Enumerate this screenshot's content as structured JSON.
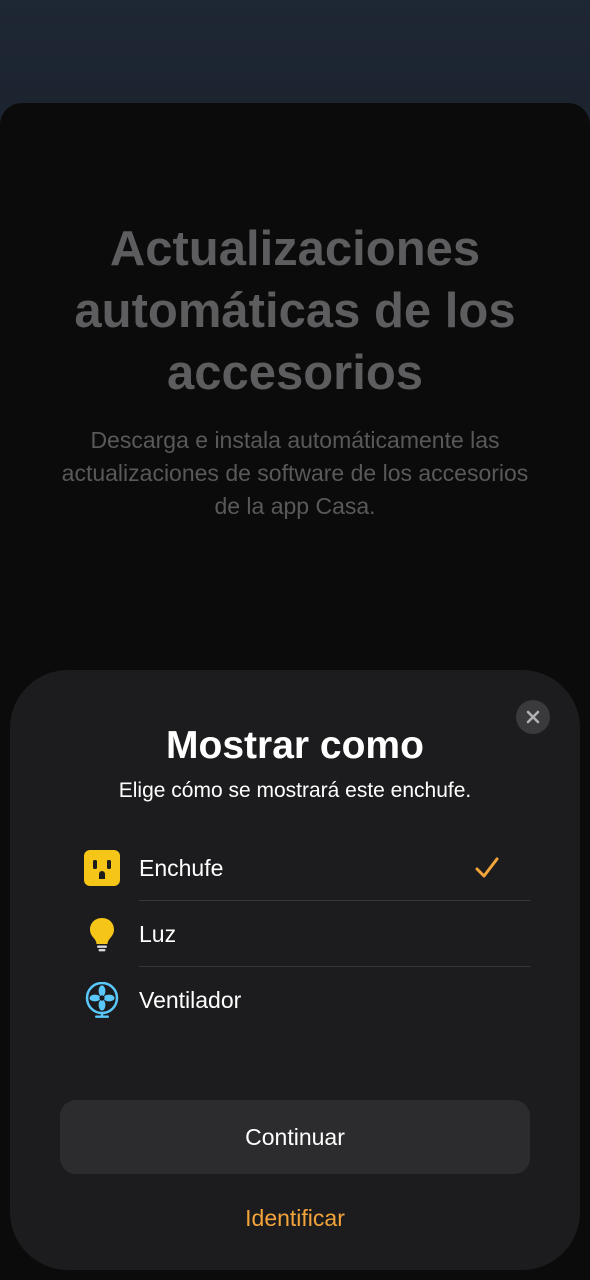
{
  "background_screen": {
    "title": "Actualizaciones automáticas de los accesorios",
    "description": "Descarga e instala automáticamente las actualizaciones de software de los accesorios de la app Casa."
  },
  "modal": {
    "close_icon": "close-icon",
    "title": "Mostrar como",
    "subtitle": "Elige cómo se mostrará este enchufe.",
    "options": [
      {
        "label": "Enchufe",
        "icon": "outlet-icon",
        "selected": true
      },
      {
        "label": "Luz",
        "icon": "lightbulb-icon",
        "selected": false
      },
      {
        "label": "Ventilador",
        "icon": "fan-icon",
        "selected": false
      }
    ],
    "continue_label": "Continuar",
    "identify_label": "Identificar"
  },
  "colors": {
    "accent": "#f2a33a",
    "outlet_icon": "#f5c518",
    "fan_icon": "#5ac8fa",
    "modal_background": "#1c1c1e",
    "button_background": "#2c2c2e"
  }
}
